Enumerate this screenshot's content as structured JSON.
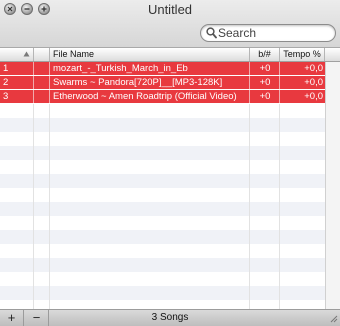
{
  "window": {
    "title": "Untitled"
  },
  "toolbar": {
    "search_placeholder": "Search"
  },
  "table": {
    "columns": {
      "index": "",
      "flag": "",
      "name": "File Name",
      "bpm": "b/#",
      "tempo": "Tempo %"
    },
    "rows": [
      {
        "index": "1",
        "name": "mozart_-_Turkish_March_in_Eb",
        "bpm": "+0",
        "tempo": "+0,0"
      },
      {
        "index": "2",
        "name": "Swarms ~ Pandora[720P]__[MP3-128K]",
        "bpm": "+0",
        "tempo": "+0,0"
      },
      {
        "index": "3",
        "name": "Etherwood ~ Amen Roadtrip (Official Video)",
        "bpm": "+0",
        "tempo": "+0,0"
      }
    ]
  },
  "footer": {
    "add_label": "+",
    "remove_label": "−",
    "song_count": "3 Songs"
  },
  "colors": {
    "selection": "#e8393f",
    "stripe": "#f0f2f7"
  }
}
